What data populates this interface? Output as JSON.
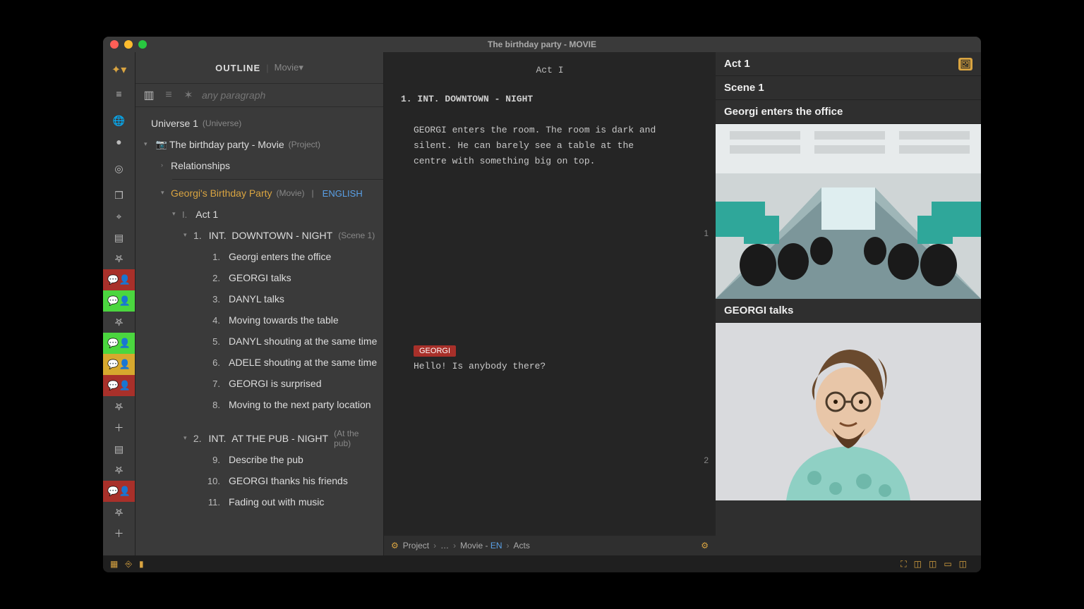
{
  "title": "The birthday party - MOVIE",
  "outline": {
    "heading": "OUTLINE",
    "mode": "Movie",
    "search_placeholder": "any paragraph",
    "universe": {
      "name": "Universe 1",
      "meta": "(Universe)"
    },
    "project": {
      "name": "The birthday party - Movie",
      "meta": "(Project)"
    },
    "relationships": "Relationships",
    "movie": {
      "name": "Georgi's Birthday Party",
      "meta": "(Movie)",
      "sep": "|",
      "lang": "ENGLISH"
    },
    "act1": {
      "roman": "I.",
      "name": "Act 1"
    },
    "scene1": {
      "num": "1.",
      "slug_int": "INT.",
      "slug_rest": "DOWNTOWN - NIGHT",
      "meta": "(Scene 1)"
    },
    "beats1": [
      {
        "n": "1.",
        "t": "Georgi enters the office"
      },
      {
        "n": "2.",
        "t": "GEORGI talks"
      },
      {
        "n": "3.",
        "t": "DANYL talks"
      },
      {
        "n": "4.",
        "t": "Moving towards the table"
      },
      {
        "n": "5.",
        "t": "DANYL shouting at the same time"
      },
      {
        "n": "6.",
        "t": "ADELE shouting at the same time"
      },
      {
        "n": "7.",
        "t": "GEORGI is surprised"
      },
      {
        "n": "8.",
        "t": "Moving to the next party location"
      }
    ],
    "scene2": {
      "num": "2.",
      "slug_int": "INT.",
      "slug_rest": "AT THE PUB - NIGHT",
      "meta": "(At the pub)"
    },
    "beats2": [
      {
        "n": "9.",
        "t": "Describe the pub"
      },
      {
        "n": "10.",
        "t": "GEORGI thanks his friends"
      },
      {
        "n": "11.",
        "t": "Fading out with music"
      }
    ]
  },
  "script": {
    "act": "Act I",
    "slug": "1.  INT. DOWNTOWN - NIGHT",
    "action": "GEORGI enters the room. The room is dark and silent. He can barely see a table at the centre with something big on top.",
    "char": "GEORGI",
    "dialogue": "Hello! Is anybody there?",
    "page1": "1",
    "page2": "2",
    "crumbs": {
      "c1": "Project",
      "c2": "…",
      "c3": "Movie - ",
      "c3b": "EN",
      "c4": "Acts"
    }
  },
  "boards": {
    "act": "Act 1",
    "scene": "Scene 1",
    "card1": "Georgi enters the office",
    "card2": "GEORGI talks"
  }
}
